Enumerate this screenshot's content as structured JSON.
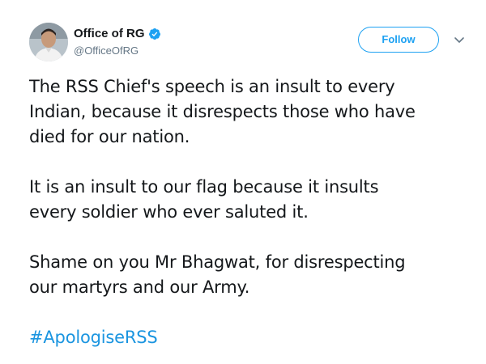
{
  "author": {
    "display_name": "Office of RG",
    "handle": "@OfficeOfRG",
    "verified": true,
    "verified_icon": "verified-badge-icon"
  },
  "actions": {
    "follow_label": "Follow",
    "more_icon": "chevron-down-icon"
  },
  "tweet": {
    "paragraphs": [
      {
        "lines": [
          "The RSS Chief's speech is an insult to every",
          "Indian, because it disrespects those who have",
          "died for our nation."
        ]
      },
      {
        "lines": [
          "It is an insult to our flag because it insults",
          "every soldier who ever saluted it."
        ]
      },
      {
        "lines": [
          "Shame on you Mr Bhagwat, for disrespecting",
          "our martyrs and our Army."
        ]
      }
    ],
    "hashtag": "#ApologiseRSS"
  },
  "colors": {
    "accent": "#1da1f2",
    "hashtag": "#1b95e0",
    "text": "#14171a",
    "secondary_text": "#657786"
  }
}
